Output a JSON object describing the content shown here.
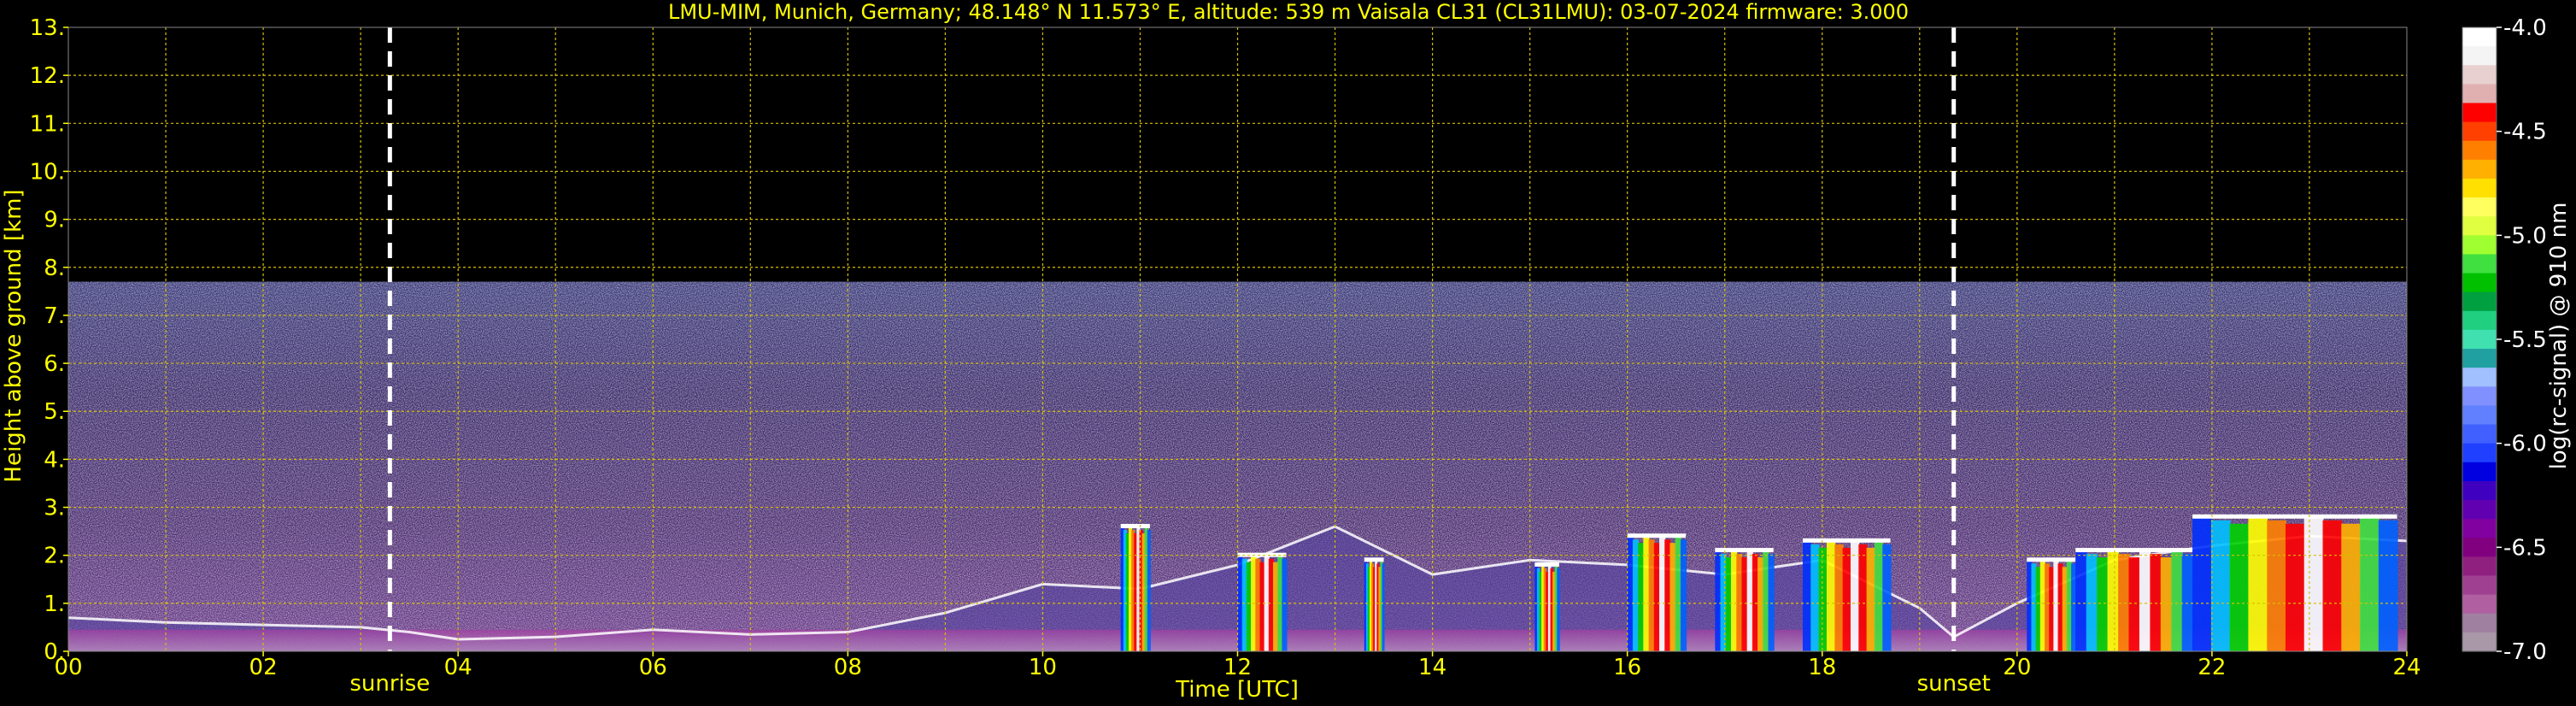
{
  "chart_data": {
    "type": "heatmap",
    "title": "LMU-MIM, Munich, Germany; 48.148° N 11.573° E, altitude: 539 m    Vaisala CL31 (CL31LMU): 03-07-2024    firmware: 3.000",
    "xlabel": "Time [UTC]",
    "ylabel": "Height above ground [km]",
    "xlim": [
      0,
      24
    ],
    "ylim": [
      0,
      13
    ],
    "x_ticks": [
      "00",
      "02",
      "04",
      "06",
      "08",
      "10",
      "12",
      "14",
      "16",
      "18",
      "20",
      "22",
      "24"
    ],
    "y_ticks": [
      "0.",
      "1.",
      "2.",
      "3.",
      "4.",
      "5.",
      "6.",
      "7.",
      "8.",
      "9.",
      "10.",
      "11.",
      "12.",
      "13."
    ],
    "grid": true,
    "markers": [
      {
        "label": "sunrise",
        "time": 3.3
      },
      {
        "label": "sunset",
        "time": 19.35
      }
    ],
    "colorbar": {
      "label": "log(rc-signal) @ 910 nm",
      "min": -7.0,
      "max": -4.0,
      "tick_labels": [
        "-4.0",
        "-4.5",
        "-5.0",
        "-5.5",
        "-6.0",
        "-6.5",
        "-7.0"
      ],
      "colors": [
        "#ffffff",
        "#f4f4f4",
        "#e8d0d0",
        "#e0b0b0",
        "#ff0000",
        "#ff4000",
        "#ff8000",
        "#ffb000",
        "#ffe000",
        "#ffff60",
        "#e0ff40",
        "#a0ff30",
        "#40e040",
        "#00c000",
        "#00a040",
        "#20d080",
        "#40e0b0",
        "#20a0a0",
        "#a0c0ff",
        "#8090ff",
        "#6080ff",
        "#4060ff",
        "#2040ff",
        "#0000e0",
        "#4000c0",
        "#6000b0",
        "#8000a0",
        "#800080",
        "#902080",
        "#a04090",
        "#b060a0",
        "#a080a0",
        "#a898a8"
      ]
    },
    "data_extent_km": 7.7,
    "boundary_layer": [
      [
        0,
        0.7
      ],
      [
        1,
        0.6
      ],
      [
        2,
        0.55
      ],
      [
        3,
        0.5
      ],
      [
        3.5,
        0.4
      ],
      [
        4,
        0.25
      ],
      [
        5,
        0.3
      ],
      [
        6,
        0.45
      ],
      [
        7,
        0.35
      ],
      [
        8,
        0.4
      ],
      [
        9,
        0.8
      ],
      [
        10,
        1.4
      ],
      [
        11,
        1.3
      ],
      [
        12,
        1.8
      ],
      [
        13,
        2.6
      ],
      [
        14,
        1.6
      ],
      [
        15,
        1.9
      ],
      [
        16,
        1.8
      ],
      [
        17,
        1.6
      ],
      [
        18,
        1.9
      ],
      [
        19,
        0.9
      ],
      [
        19.35,
        0.3
      ],
      [
        20,
        1.0
      ],
      [
        21,
        1.9
      ],
      [
        22,
        2.2
      ],
      [
        23,
        2.4
      ],
      [
        24,
        2.3
      ]
    ],
    "cloud_columns": [
      {
        "t0": 10.8,
        "t1": 11.1,
        "top": 2.6
      },
      {
        "t0": 12.0,
        "t1": 12.5,
        "top": 2.0
      },
      {
        "t0": 13.3,
        "t1": 13.5,
        "top": 1.9
      },
      {
        "t0": 15.05,
        "t1": 15.3,
        "top": 1.8
      },
      {
        "t0": 16.0,
        "t1": 16.6,
        "top": 2.4
      },
      {
        "t0": 16.9,
        "t1": 17.5,
        "top": 2.1
      },
      {
        "t0": 17.8,
        "t1": 18.7,
        "top": 2.3
      },
      {
        "t0": 20.1,
        "t1": 20.6,
        "top": 1.9
      },
      {
        "t0": 20.6,
        "t1": 21.8,
        "top": 2.1
      },
      {
        "t0": 21.8,
        "t1": 23.9,
        "top": 2.8
      }
    ]
  }
}
